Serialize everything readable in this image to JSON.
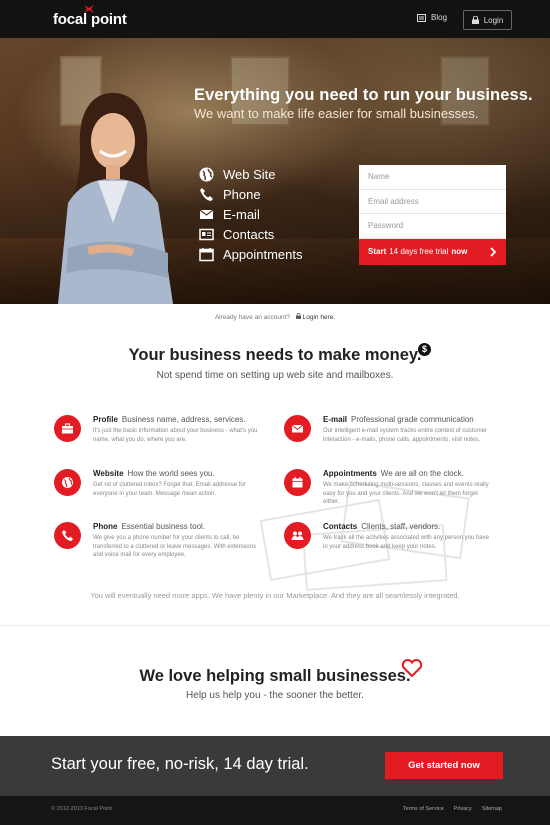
{
  "header": {
    "logo": "focal point",
    "blog_label": "Blog",
    "login_label": "Login"
  },
  "hero": {
    "headline": "Everything you need to run your business.",
    "subheadline": "We want to make life easier for small businesses.",
    "features": [
      {
        "label": "Web Site",
        "icon": "globe-icon"
      },
      {
        "label": "Phone",
        "icon": "phone-icon"
      },
      {
        "label": "E-mail",
        "icon": "envelope-icon"
      },
      {
        "label": "Contacts",
        "icon": "contact-card-icon"
      },
      {
        "label": "Appointments",
        "icon": "calendar-icon"
      }
    ],
    "form": {
      "name_placeholder": "Name",
      "email_placeholder": "Email address",
      "password_placeholder": "Password",
      "button_start": "Start",
      "button_middle": "14 days free trial",
      "button_now": "now"
    }
  },
  "already": {
    "text": "Already have an account?",
    "login_link": "Login here."
  },
  "money_section": {
    "title": "Your business needs to make money.",
    "dollar": "$",
    "subtitle": "Not spend time on setting up web site and mailboxes.",
    "apps": [
      {
        "name": "Profile",
        "tagline": "Business name, address, services.",
        "desc": "It's just the basic information about your business - what's you name, what you do, where you are.",
        "icon": "briefcase-icon"
      },
      {
        "name": "E-mail",
        "tagline": "Professional grade communication",
        "desc": "Our intelligent e-mail system tracks entire context of customer interaction - e-mails, phone calls, appointments, visit notes.",
        "icon": "envelope-icon"
      },
      {
        "name": "Website",
        "tagline": "How the world sees you.",
        "desc": "Get rid of cluttered inbox? Forget that. Email addresse for everyone in your team. Message mean action.",
        "icon": "globe-icon"
      },
      {
        "name": "Appointments",
        "tagline": "We are all on the clock.",
        "desc": "We make scheduling multi-sessions, classes and events really easy for you and your clients. And we won't let them forget either.",
        "icon": "calendar-icon"
      },
      {
        "name": "Phone",
        "tagline": "Essential business tool.",
        "desc": "We give you a phone number for your clients to call, be transferred to a cluttered or leave messages. With extensions and voice mail for every employee.",
        "icon": "phone-icon"
      },
      {
        "name": "Contacts",
        "tagline": "Clients, staff, vendors.",
        "desc": "We track all the activities associated with any person you have in your address book and keep your notes.",
        "icon": "people-icon"
      }
    ],
    "more_text": "You will eventually need more apps. We have plenty in our Marketplace. And they are all seamlessly integrated."
  },
  "love_section": {
    "title": "We love helping small businesses.",
    "subtitle": "Help us help you - the sooner the better."
  },
  "cta": {
    "text": "Start your free, no-risk, 14 day trial.",
    "button": "Get started now"
  },
  "footer": {
    "copyright": "© 2012-2013 Focal Point",
    "links": [
      "Terms of Service",
      "Privacy",
      "Sitemap"
    ]
  },
  "colors": {
    "accent": "#e31b23",
    "topbar": "#121212",
    "cta_bg": "#3a3a3a",
    "footer_bg": "#151515"
  }
}
